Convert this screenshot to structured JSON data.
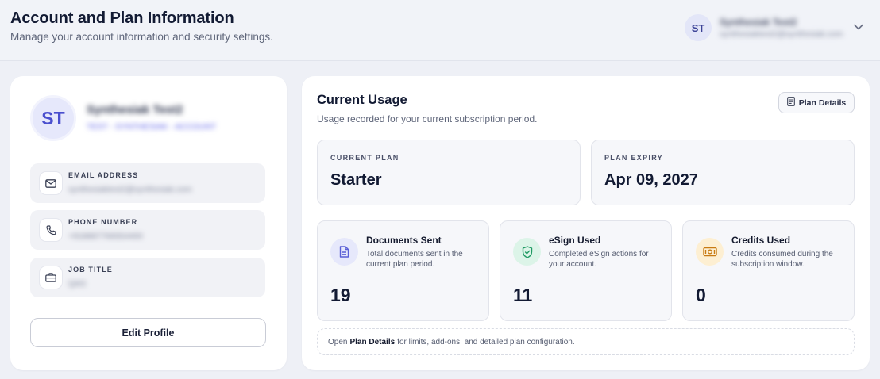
{
  "header": {
    "title": "Account and Plan Information",
    "subtitle": "Manage your account information and security settings.",
    "user": {
      "initials": "ST",
      "name": "Synthesiak Test2",
      "email": "synthesiaktest2@synthesiak.com"
    }
  },
  "profile": {
    "initials": "ST",
    "name": "Synthesiak Test2",
    "role": "TEST - SYNTHESIAK - ACCOUNT",
    "fields": [
      {
        "icon": "mail-icon",
        "label": "EMAIL ADDRESS",
        "value": "synthesiaktest2@synthesiak.com"
      },
      {
        "icon": "phone-icon",
        "label": "PHONE NUMBER",
        "value": "+918887766554400"
      },
      {
        "icon": "briefcase-icon",
        "label": "JOB TITLE",
        "value": "QAS"
      }
    ],
    "edit_label": "Edit Profile"
  },
  "usage": {
    "title": "Current Usage",
    "subtitle": "Usage recorded for your current subscription period.",
    "plan_details_label": "Plan Details",
    "current_plan": {
      "label": "CURRENT PLAN",
      "value": "Starter"
    },
    "plan_expiry": {
      "label": "PLAN EXPIRY",
      "value": "Apr 09, 2027"
    },
    "metrics": [
      {
        "icon": "document-icon",
        "title": "Documents Sent",
        "description": "Total documents sent in the current plan period.",
        "value": "19",
        "color": "#5a5fd6",
        "bg": "#e6e8fb"
      },
      {
        "icon": "shield-check-icon",
        "title": "eSign Used",
        "description": "Completed eSign actions for your account.",
        "value": "11",
        "color": "#1f9a63",
        "bg": "#dcf4e8"
      },
      {
        "icon": "money-icon",
        "title": "Credits Used",
        "description": "Credits consumed during the subscription window.",
        "value": "0",
        "color": "#c97b12",
        "bg": "#fdefd2"
      }
    ],
    "footer": {
      "prefix": "Open",
      "link": "Plan Details",
      "suffix": "for limits, add-ons, and detailed plan configuration."
    }
  }
}
